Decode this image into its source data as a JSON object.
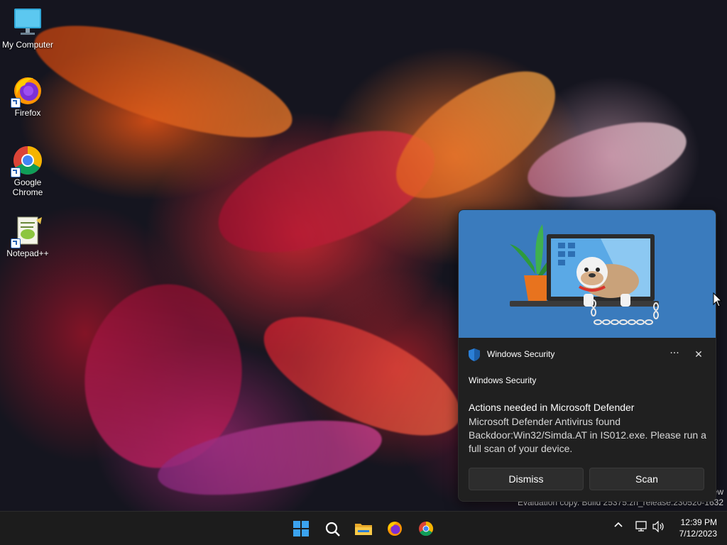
{
  "desktop": {
    "icons": [
      {
        "label": "My Computer",
        "icon": "computer-icon"
      },
      {
        "label": "Firefox",
        "icon": "firefox-icon"
      },
      {
        "label": "Google Chrome",
        "icon": "chrome-icon"
      },
      {
        "label": "Notepad++",
        "icon": "notepadpp-icon"
      }
    ],
    "watermark_line1": "ew",
    "watermark_line2": "Evaluation copy. Build 25375.zn_release.230520-1632"
  },
  "toast": {
    "app_name": "Windows Security",
    "more_label": "···",
    "close_label": "✕",
    "subtitle": "Windows Security",
    "title": "Actions needed in Microsoft Defender",
    "body": "Microsoft Defender Antivirus found Backdoor:Win32/Simda.AT in IS012.exe. Please run a full scan of your device.",
    "buttons": {
      "dismiss": "Dismiss",
      "scan": "Scan"
    },
    "hero_color": "#3a7bbd"
  },
  "taskbar": {
    "apps": [
      {
        "name": "start",
        "icon": "windows-logo-icon"
      },
      {
        "name": "search",
        "icon": "search-icon"
      },
      {
        "name": "file-explorer",
        "icon": "folder-icon"
      },
      {
        "name": "firefox",
        "icon": "firefox-icon"
      },
      {
        "name": "chrome",
        "icon": "chrome-icon"
      }
    ],
    "tray": {
      "overflow": "^",
      "icons": [
        "network-icon",
        "volume-icon"
      ]
    },
    "clock": {
      "time": "12:39 PM",
      "date": "7/12/2023"
    }
  }
}
